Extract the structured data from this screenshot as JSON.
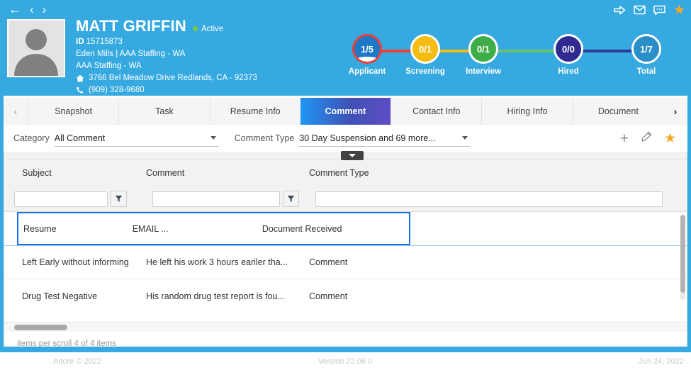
{
  "header": {
    "nav": {
      "back_icon": "arrow-left-icon",
      "prev_icon": "chevron-left-icon",
      "next_icon": "chevron-right-icon"
    },
    "icons": [
      {
        "name": "share-arrow-icon",
        "glyph": "⇨"
      },
      {
        "name": "mail-icon",
        "glyph": "✉"
      },
      {
        "name": "message-icon",
        "glyph": "὞9"
      },
      {
        "name": "favorite-star-icon",
        "glyph": "★"
      }
    ],
    "person": {
      "name": "MATT GRIFFIN",
      "status": "Active",
      "status_color": "#7ac943",
      "id_label": "ID",
      "id_value": "15715873",
      "branch": "Eden Mills | AAA Staffing - WA",
      "company": "AAA Staffing - WA",
      "address": "3766 Bel Meadow Drive Redlands, CA - 92373",
      "phone": "(909) 328-9680",
      "address_icon": "home-icon",
      "phone_icon": "phone-icon",
      "avatar_icon": "user-avatar-placeholder-icon"
    },
    "background_color": "#36a9e1"
  },
  "pipeline": [
    {
      "label": "Applicant",
      "value": "1/5",
      "ring_color": "#ef3e36",
      "fill_color": "#1e78c8",
      "line_color": "#ef3e36",
      "has_wave": true
    },
    {
      "label": "Screening",
      "value": "0/1",
      "ring_color": "#ffffff",
      "fill_color": "#f5bc14",
      "line_color": "#f5bc14",
      "has_wave": false
    },
    {
      "label": "Interview",
      "value": "0/1",
      "ring_color": "#ffffff",
      "fill_color": "#3fae49",
      "line_color": "#64c36a",
      "has_wave": false
    },
    {
      "label": "Hired",
      "value": "0/0",
      "ring_color": "#ffffff",
      "fill_color": "#2e2a8f",
      "line_color": "#2b3a97",
      "has_wave": false
    },
    {
      "label": "Total",
      "value": "1/7",
      "ring_color": "#ffffff",
      "fill_color": "#2a8fc9",
      "line_color": "#2b3a97",
      "has_wave": false
    }
  ],
  "tabs": {
    "scroll_left_icon": "chevron-left-icon",
    "scroll_right_icon": "chevron-right-icon",
    "items": [
      {
        "label": "Snapshot",
        "active": false
      },
      {
        "label": "Task",
        "active": false
      },
      {
        "label": "Resume Info",
        "active": false
      },
      {
        "label": "Comment",
        "active": true
      },
      {
        "label": "Contact Info",
        "active": false
      },
      {
        "label": "Hiring Info",
        "active": false
      },
      {
        "label": "Document",
        "active": false
      }
    ]
  },
  "filter_bar": {
    "category_label": "Category",
    "category_value": "All Comment",
    "comment_type_label": "Comment Type",
    "comment_type_value": "30 Day Suspension and 69 more...",
    "actions": {
      "add_label": "+",
      "add_icon": "plus-icon",
      "edit_icon": "pencil-icon",
      "star_icon": "star-icon",
      "star_color": "#f5a623"
    }
  },
  "grid": {
    "collapse_icon": "chevron-down-icon",
    "columns": [
      "Subject",
      "Comment",
      "Comment Type",
      ""
    ],
    "filter_icon": "funnel-icon",
    "filter_values": [
      "",
      "",
      ""
    ],
    "rows": [
      {
        "subject": "Resume",
        "comment": "EMAIL   ...",
        "comment_type": "Document Received",
        "extra": "",
        "selected": true
      },
      {
        "subject": "Left Early without informing",
        "comment": "He left his work 3 hours eariler tha...",
        "comment_type": "Comment",
        "extra": "",
        "selected": false
      },
      {
        "subject": "Drug Test Negative",
        "comment": "His random drug test report is fou...",
        "comment_type": "Comment",
        "extra": "",
        "selected": false
      }
    ],
    "status_text": "items per scroll 4 of 4 items",
    "selection_color": "#1a73e8"
  },
  "footer": {
    "copyright": "Aqore © 2022",
    "version": "Version 22.06.0",
    "date": "Jun 24, 2022"
  }
}
